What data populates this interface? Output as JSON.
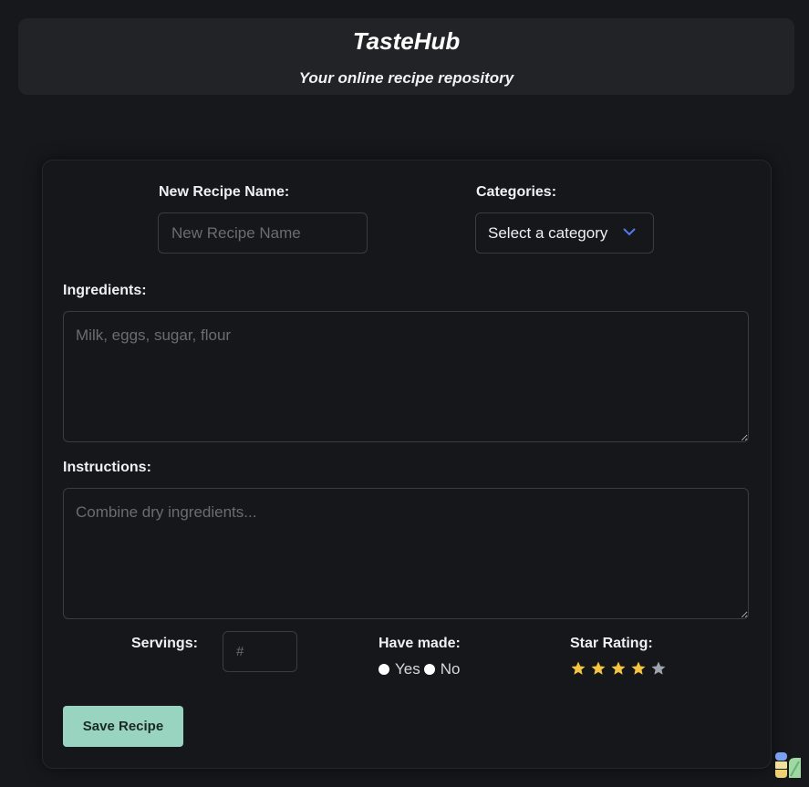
{
  "header": {
    "title": "TasteHub",
    "subtitle": "Your online recipe repository"
  },
  "form": {
    "recipe_name": {
      "label": "New Recipe Name:",
      "placeholder": "New Recipe Name",
      "value": ""
    },
    "categories": {
      "label": "Categories:",
      "selected": "Select a category"
    },
    "ingredients": {
      "label": "Ingredients:",
      "placeholder": "Milk, eggs, sugar, flour",
      "value": ""
    },
    "instructions": {
      "label": "Instructions:",
      "placeholder": "Combine dry ingredients...",
      "value": ""
    },
    "servings": {
      "label": "Servings:",
      "placeholder": "#",
      "value": ""
    },
    "have_made": {
      "label": "Have made:",
      "options": [
        "Yes",
        "No"
      ]
    },
    "star_rating": {
      "label": "Star Rating:",
      "rating": 4,
      "max": 5
    },
    "save_label": "Save Recipe"
  },
  "colors": {
    "accent_button": "#98d4bf",
    "star_filled": "#f5c542",
    "star_empty": "#9ea3b0",
    "chevron": "#4f7df0"
  }
}
